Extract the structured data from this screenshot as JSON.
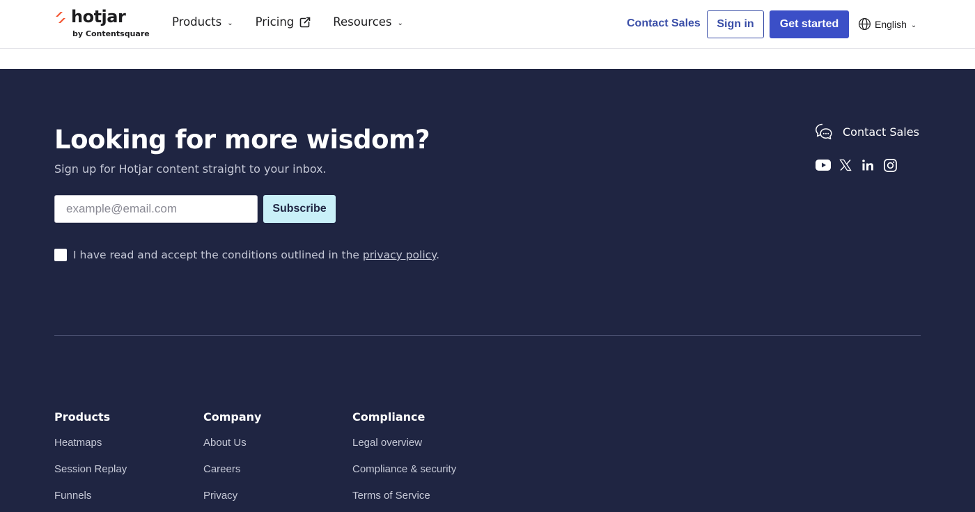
{
  "header": {
    "logo_word": "hotjar",
    "logo_sub": "by Contentsquare",
    "nav": [
      {
        "label": "Products"
      },
      {
        "label": "Pricing"
      },
      {
        "label": "Resources"
      }
    ],
    "contact_sales": "Contact Sales",
    "sign_in": "Sign in",
    "get_started": "Get started",
    "language": "English"
  },
  "newsletter": {
    "headline": "Looking for more wisdom?",
    "subline": "Sign up for Hotjar content straight to your inbox.",
    "email_placeholder": "example@email.com",
    "subscribe_label": "Subscribe",
    "consent_prefix": "I have read and accept the conditions outlined in the ",
    "consent_link": "privacy policy",
    "consent_suffix": "."
  },
  "footer_contact": {
    "contact_sales": "Contact Sales",
    "social_icons": [
      "youtube-icon",
      "x-icon",
      "linkedin-icon",
      "instagram-icon"
    ]
  },
  "footer_columns": [
    {
      "title": "Products",
      "links": [
        "Heatmaps",
        "Session Replay",
        "Funnels"
      ]
    },
    {
      "title": "Company",
      "links": [
        "About Us",
        "Careers",
        "Privacy"
      ]
    },
    {
      "title": "Compliance",
      "links": [
        "Legal overview",
        "Compliance & security",
        "Terms of Service"
      ]
    }
  ],
  "colors": {
    "brand_red": "#f4532e",
    "accent_blue": "#3b4fc7",
    "footer_bg": "#1f2542",
    "subscribe_bg": "#c9f0f8"
  }
}
